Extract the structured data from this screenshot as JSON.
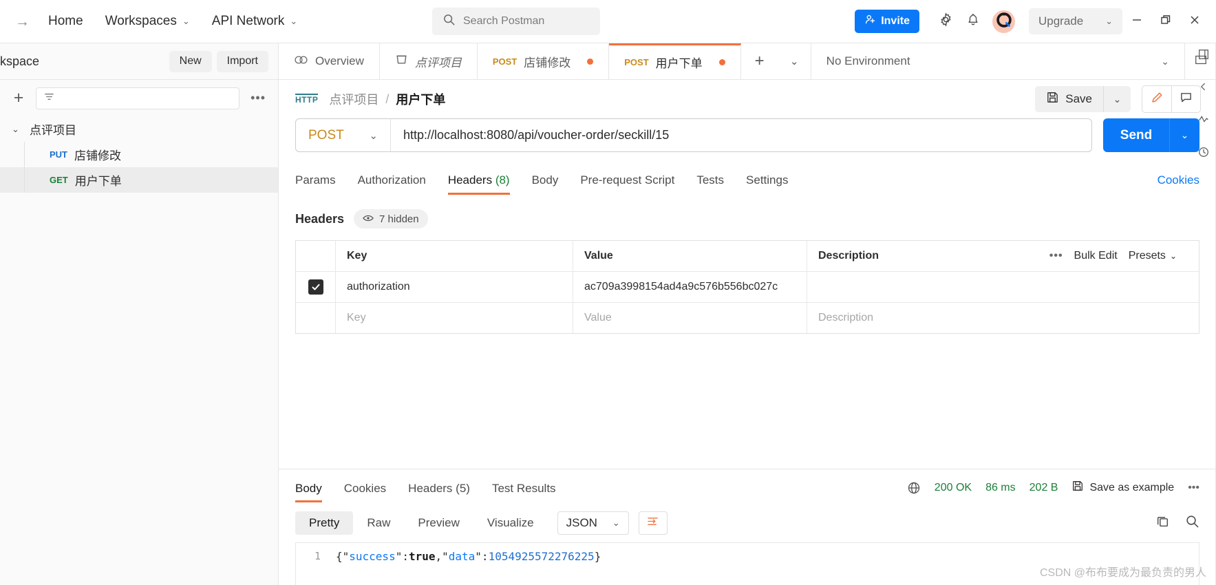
{
  "topbar": {
    "back_arrow": "→",
    "links": [
      {
        "label": "Home",
        "caret": ""
      },
      {
        "label": "Workspaces",
        "caret": "⌄"
      },
      {
        "label": "API Network",
        "caret": "⌄"
      }
    ],
    "search_placeholder": "Search Postman",
    "invite_label": "Invite",
    "upgrade_label": "Upgrade",
    "upgrade_caret": "⌄",
    "icons": [
      "search-icon",
      "invite-person-icon",
      "gear-icon",
      "bell-icon",
      "avatar-icon",
      "minimize-icon",
      "restore-icon",
      "close-icon"
    ]
  },
  "sidebar": {
    "workspace_title": "rkspace",
    "new_label": "New",
    "import_label": "Import",
    "filter_placeholder": "",
    "collection": {
      "caret": "⌄",
      "name": "点评项目",
      "requests": [
        {
          "method": "PUT",
          "name": "店铺修改",
          "selected": false
        },
        {
          "method": "GET",
          "name": "用户下单",
          "selected": true
        }
      ]
    }
  },
  "tabbar": {
    "tabs": [
      {
        "label": "Overview",
        "method": "",
        "italic": false,
        "dirty": false,
        "active": false,
        "icon": "overview-icon"
      },
      {
        "label": "点评项目",
        "method": "",
        "italic": true,
        "dirty": false,
        "active": false,
        "icon": "collection-icon"
      },
      {
        "label": "店铺修改",
        "method": "POST",
        "italic": false,
        "dirty": true,
        "active": false,
        "icon": ""
      },
      {
        "label": "用户下单",
        "method": "POST",
        "italic": false,
        "dirty": true,
        "active": true,
        "icon": ""
      }
    ],
    "add_label": "+",
    "chevron": "⌄",
    "environment": "No Environment",
    "env_chevron": "⌄"
  },
  "request": {
    "breadcrumb": {
      "protocol": "HTTP",
      "collection": "点评项目",
      "separator": "/",
      "name": "用户下单"
    },
    "save_label": "Save",
    "save_chevron": "⌄",
    "method": "POST",
    "method_chevron": "⌄",
    "url": "http://localhost:8080/api/voucher-order/seckill/15",
    "send_label": "Send",
    "send_chevron": "⌄",
    "tabs": [
      {
        "label": "Params",
        "count": "",
        "active": false
      },
      {
        "label": "Authorization",
        "count": "",
        "active": false
      },
      {
        "label": "Headers",
        "count": "(8)",
        "active": true
      },
      {
        "label": "Body",
        "count": "",
        "active": false
      },
      {
        "label": "Pre-request Script",
        "count": "",
        "active": false
      },
      {
        "label": "Tests",
        "count": "",
        "active": false
      },
      {
        "label": "Settings",
        "count": "",
        "active": false
      }
    ],
    "cookies_link": "Cookies"
  },
  "headers_panel": {
    "label": "Headers",
    "hidden_pill": "7 hidden",
    "columns": {
      "key": "Key",
      "value": "Value",
      "description": "Description"
    },
    "actions": {
      "dots": "•••",
      "bulk_edit": "Bulk Edit",
      "presets": "Presets",
      "presets_caret": "⌄"
    },
    "rows": [
      {
        "checked": true,
        "key": "authorization",
        "value": "ac709a3998154ad4a9c576b556bc027c",
        "description": ""
      }
    ],
    "empty_row": {
      "key": "Key",
      "value": "Value",
      "description": "Description"
    }
  },
  "response": {
    "tabs": [
      {
        "label": "Body",
        "count": "",
        "active": true
      },
      {
        "label": "Cookies",
        "count": "",
        "active": false
      },
      {
        "label": "Headers",
        "count": "(5)",
        "active": false
      },
      {
        "label": "Test Results",
        "count": "",
        "active": false
      }
    ],
    "status": "200 OK",
    "time": "86 ms",
    "size": "202 B",
    "save_example": "Save as example",
    "more_dots": "•••",
    "format_tabs": [
      {
        "label": "Pretty",
        "active": true
      },
      {
        "label": "Raw",
        "active": false
      },
      {
        "label": "Preview",
        "active": false
      },
      {
        "label": "Visualize",
        "active": false
      }
    ],
    "language": "JSON",
    "language_caret": "⌄",
    "line_number": "1",
    "body_tokens": [
      {
        "t": "{\"",
        "c": "punct"
      },
      {
        "t": "success",
        "c": "key"
      },
      {
        "t": "\":",
        "c": "punct"
      },
      {
        "t": "true",
        "c": "bool"
      },
      {
        "t": ",\"",
        "c": "punct"
      },
      {
        "t": "data",
        "c": "key"
      },
      {
        "t": "\":",
        "c": "punct"
      },
      {
        "t": "1054925572276225",
        "c": "num"
      },
      {
        "t": "}",
        "c": "punct"
      }
    ],
    "body_raw": "{\"success\":true,\"data\":1054925572276225}"
  },
  "watermark": "CSDN @布布要成为最负责的男人",
  "colors": {
    "accent_orange": "#f2703a",
    "blue": "#0b79f7",
    "green": "#1a7f37",
    "method_post": "#c98a1b"
  }
}
